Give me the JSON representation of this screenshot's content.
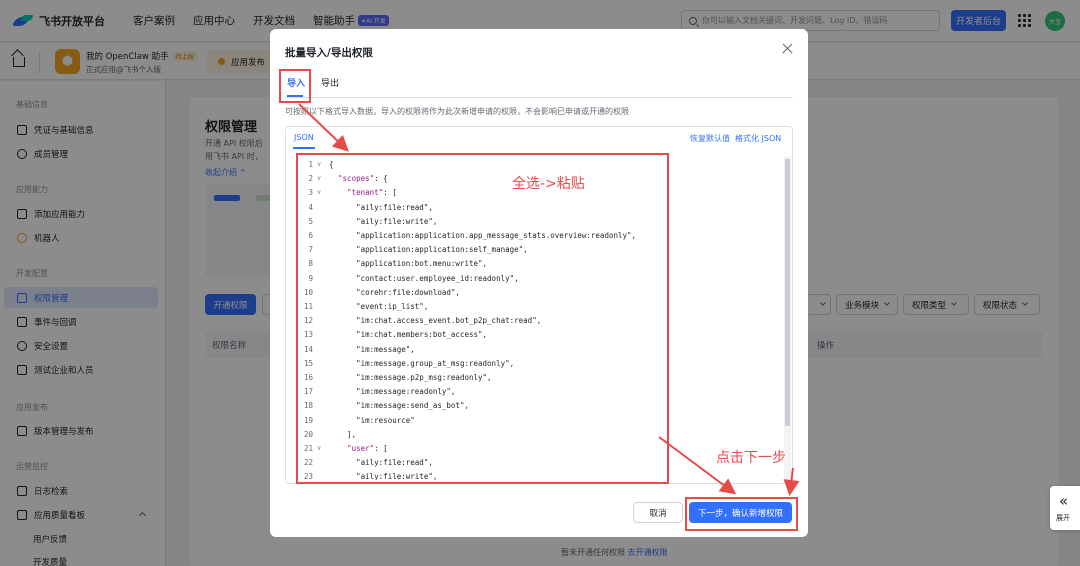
{
  "topbar": {
    "logo_text": "飞书开放平台",
    "nav": [
      "客户案例",
      "应用中心",
      "开发文档",
      "智能助手"
    ],
    "ai_badge": "✦AI 开发",
    "search_placeholder": "你可以输入文档关键词、开发问题、Log ID、错误码",
    "dev_console": "开发者后台",
    "avatar_text": "大宝"
  },
  "app": {
    "name": "我的 OpenClaw 助手",
    "status_badge": "待上线",
    "subtitle": "正式应用@飞书个人版",
    "publish_chip": "应用发布"
  },
  "sidebar": {
    "groups": [
      "基础信息",
      "应用能力",
      "开发配置",
      "应用发布",
      "运营监控"
    ],
    "items": [
      "凭证与基础信息",
      "成员管理",
      "添加应用能力",
      "机器人",
      "权限管理",
      "事件与回调",
      "安全设置",
      "测试企业和人员",
      "版本管理与发布",
      "日志检索",
      "应用质量看板"
    ],
    "sub_items": [
      "用户反馈",
      "开发质量"
    ],
    "active_item": "权限管理"
  },
  "page": {
    "title": "权限管理",
    "desc_line1": "开通 API 权限后",
    "desc_line2": "用飞书 API 时，",
    "intro_link": "收起介绍 ^",
    "open_perm_button": "开通权限",
    "filters": [
      "业务模块",
      "权限类型",
      "权限状态"
    ],
    "table_headers": [
      "权限名称",
      "操作"
    ],
    "empty_text": "暂未开通任何权限",
    "empty_link": "去开通权限"
  },
  "expand_panel": {
    "icon": "«",
    "label": "展开"
  },
  "modal": {
    "title": "批量导入/导出权限",
    "tabs": [
      "导入",
      "导出"
    ],
    "active_tab": "导入",
    "description": "可按照以下格式导入数据，导入的权限将作为此次新增申请的权限，不会影响已申请或开通的权限",
    "editor_tab": "JSON",
    "editor_actions": [
      "恢复默认值",
      "格式化 JSON"
    ],
    "code_lines": [
      {
        "n": "1",
        "fold": true,
        "text": "{"
      },
      {
        "n": "2",
        "fold": true,
        "text": "  \"scopes\": {"
      },
      {
        "n": "3",
        "fold": true,
        "text": "    \"tenant\": ["
      },
      {
        "n": "4",
        "fold": false,
        "text": "      \"aily:file:read\","
      },
      {
        "n": "5",
        "fold": false,
        "text": "      \"aily:file:write\","
      },
      {
        "n": "6",
        "fold": false,
        "text": "      \"application:application.app_message_stats.overview:readonly\","
      },
      {
        "n": "7",
        "fold": false,
        "text": "      \"application:application:self_manage\","
      },
      {
        "n": "8",
        "fold": false,
        "text": "      \"application:bot.menu:write\","
      },
      {
        "n": "9",
        "fold": false,
        "text": "      \"contact:user.employee_id:readonly\","
      },
      {
        "n": "10",
        "fold": false,
        "text": "      \"corehr:file:download\","
      },
      {
        "n": "11",
        "fold": false,
        "text": "      \"event:ip_list\","
      },
      {
        "n": "12",
        "fold": false,
        "text": "      \"im:chat.access_event.bot_p2p_chat:read\","
      },
      {
        "n": "13",
        "fold": false,
        "text": "      \"im:chat.members:bot_access\","
      },
      {
        "n": "14",
        "fold": false,
        "text": "      \"im:message\","
      },
      {
        "n": "15",
        "fold": false,
        "text": "      \"im:message.group_at_msg:readonly\","
      },
      {
        "n": "16",
        "fold": false,
        "text": "      \"im:message.p2p_msg:readonly\","
      },
      {
        "n": "17",
        "fold": false,
        "text": "      \"im:message:readonly\","
      },
      {
        "n": "18",
        "fold": false,
        "text": "      \"im:message:send_as_bot\","
      },
      {
        "n": "19",
        "fold": false,
        "text": "      \"im:resource\""
      },
      {
        "n": "20",
        "fold": false,
        "text": "    ],"
      },
      {
        "n": "21",
        "fold": true,
        "text": "    \"user\": ["
      },
      {
        "n": "22",
        "fold": false,
        "text": "      \"aily:file:read\","
      },
      {
        "n": "23",
        "fold": false,
        "text": "      \"aily:file:write\","
      }
    ],
    "cancel_button": "取消",
    "next_button": "下一步，确认新增权限"
  },
  "annotations": {
    "select_paste": "全选->粘贴",
    "click_next": "点击下一步",
    "color": "#e84a4a"
  },
  "colors": {
    "accent": "#3370ff",
    "annotation": "#e84a4a"
  }
}
